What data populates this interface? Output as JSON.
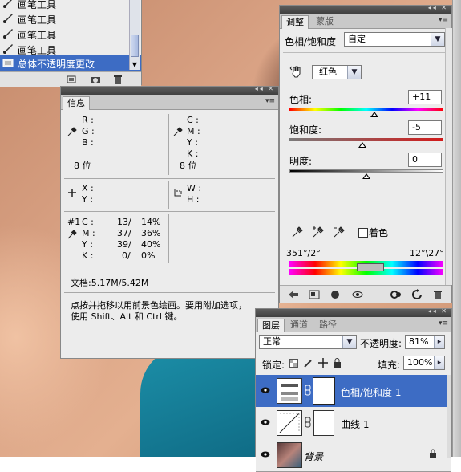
{
  "history": {
    "items": [
      {
        "label": "画笔工具"
      },
      {
        "label": "画笔工具"
      },
      {
        "label": "画笔工具"
      },
      {
        "label": "画笔工具"
      },
      {
        "label": "总体不透明度更改"
      }
    ]
  },
  "info": {
    "tab": "信息",
    "rgb": {
      "r_label": "R :",
      "g_label": "G :",
      "b_label": "B :",
      "bits": "8 位"
    },
    "cmyk": {
      "c_label": "C :",
      "m_label": "M :",
      "y_label": "Y :",
      "k_label": "K :",
      "bits": "8 位"
    },
    "xy": {
      "x_label": "X :",
      "y_label": "Y :"
    },
    "wh": {
      "w_label": "W :",
      "h_label": "H :"
    },
    "sample": {
      "id_label": "#1",
      "rows": [
        {
          "ch": "C :",
          "v1": "13/",
          "v2": "14%"
        },
        {
          "ch": "M :",
          "v1": "37/",
          "v2": "36%"
        },
        {
          "ch": "Y :",
          "v1": "39/",
          "v2": "40%"
        },
        {
          "ch": "K :",
          "v1": "0/",
          "v2": "0%"
        }
      ]
    },
    "doc": "文档:5.17M/5.42M",
    "hint_line1": "点按并拖移以用前景色绘画。要用附加选项，",
    "hint_line2": "使用 Shift、Alt 和 Ctrl 键。"
  },
  "adjust": {
    "tabs": [
      "调整",
      "蒙版"
    ],
    "title": "色相/饱和度",
    "preset": "自定",
    "channel": "红色",
    "hue_label": "色相:",
    "hue_value": "+11",
    "sat_label": "饱和度:",
    "sat_value": "-5",
    "light_label": "明度:",
    "light_value": "0",
    "colorize_label": "着色",
    "range_left": "351°/2°",
    "range_right": "12°\\27°",
    "colors": {
      "accent": "#3d6cc4"
    }
  },
  "layers": {
    "tabs": [
      "图层",
      "通道",
      "路径"
    ],
    "blend_mode": "正常",
    "opacity_label": "不透明度:",
    "opacity_value": "81%",
    "lock_label": "锁定:",
    "fill_label": "填充:",
    "fill_value": "100%",
    "rows": [
      {
        "name": "色相/饱和度 1"
      },
      {
        "name": "曲线 1"
      },
      {
        "name": "背景"
      }
    ]
  }
}
